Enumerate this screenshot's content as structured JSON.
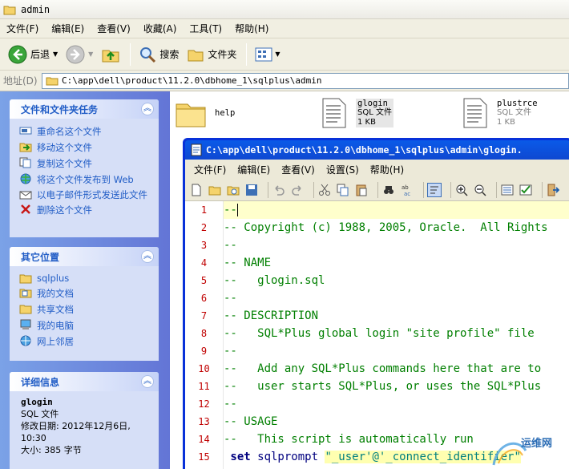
{
  "window": {
    "title": "admin"
  },
  "menu": [
    "文件(F)",
    "编辑(E)",
    "查看(V)",
    "收藏(A)",
    "工具(T)",
    "帮助(H)"
  ],
  "toolbar": {
    "back": "后退",
    "search": "搜索",
    "folders": "文件夹"
  },
  "address": {
    "label": "地址(D)",
    "path": "C:\\app\\dell\\product\\11.2.0\\dbhome_1\\sqlplus\\admin"
  },
  "tasks": {
    "title": "文件和文件夹任务",
    "items": [
      "重命名这个文件",
      "移动这个文件",
      "复制这个文件",
      "将这个文件发布到 Web",
      "以电子邮件形式发送此文件",
      "删除这个文件"
    ]
  },
  "places": {
    "title": "其它位置",
    "items": [
      "sqlplus",
      "我的文档",
      "共享文档",
      "我的电脑",
      "网上邻居"
    ]
  },
  "details": {
    "title": "详细信息",
    "name": "glogin",
    "type": "SQL 文件",
    "modified": "修改日期: 2012年12月6日, 10:30",
    "size": "大小: 385 字节"
  },
  "files": [
    {
      "name": "help",
      "type": "",
      "size": ""
    },
    {
      "name": "glogin",
      "type": "SQL 文件",
      "size": "1 KB"
    },
    {
      "name": "plustrce",
      "type": "SQL 文件",
      "size": "1 KB"
    }
  ],
  "editor": {
    "title": "C:\\app\\dell\\product\\11.2.0\\dbhome_1\\sqlplus\\admin\\glogin.",
    "menu": [
      "文件(F)",
      "编辑(E)",
      "查看(V)",
      "设置(S)",
      "帮助(H)"
    ],
    "line_numbers": [
      "1",
      "2",
      "3",
      "4",
      "5",
      "6",
      "7",
      "8",
      "9",
      "10",
      "11",
      "12",
      "13",
      "14",
      "15"
    ],
    "lines": [
      "--",
      "-- Copyright (c) 1988, 2005, Oracle.  All Rights",
      "--",
      "-- NAME",
      "--   glogin.sql",
      "--",
      "-- DESCRIPTION",
      "--   SQL*Plus global login \"site profile\" file",
      "--",
      "--   Add any SQL*Plus commands here that are to",
      "--   user starts SQL*Plus, or uses the SQL*Plus",
      "--",
      "-- USAGE",
      "--   This script is automatically run",
      ""
    ],
    "line15": {
      "kw": "set",
      "text": " sqlprompt ",
      "str": "\"_user'@'_connect_identifier\""
    }
  },
  "watermark": "运维网",
  "colors": {
    "accent": "#215dc6",
    "line_number": "#c00000",
    "comment": "#007f00"
  }
}
